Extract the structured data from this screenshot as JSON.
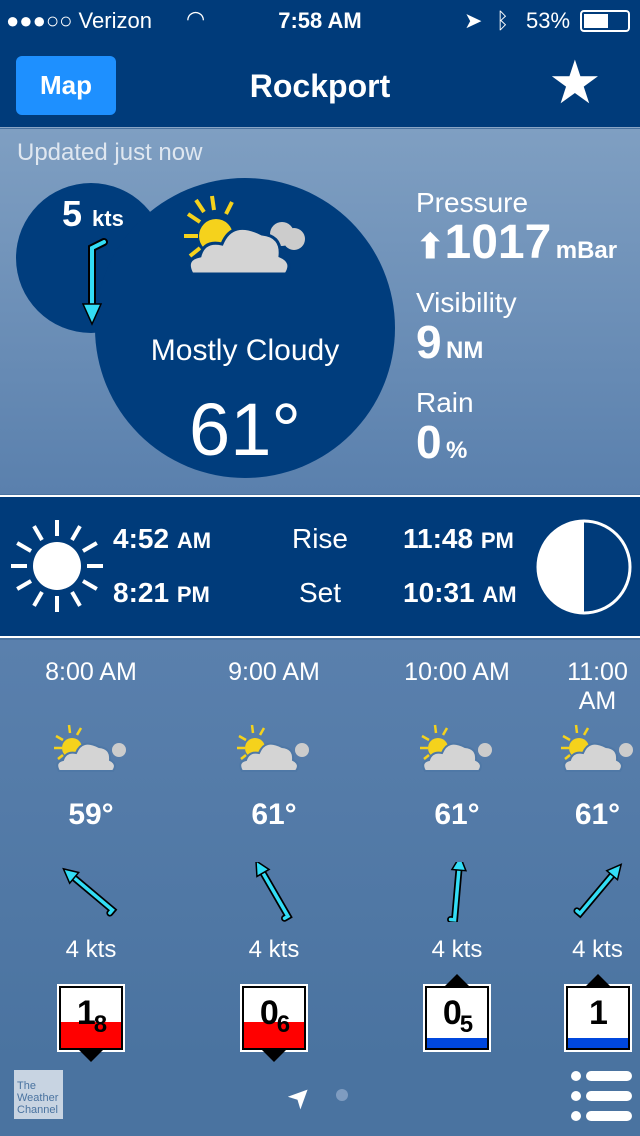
{
  "status": {
    "carrier": "●●●○○ Verizon",
    "time": "7:58 AM",
    "battery": "53%"
  },
  "nav": {
    "map_label": "Map",
    "title": "Rockport"
  },
  "current": {
    "updated": "Updated just now",
    "wind_speed": "5",
    "wind_unit": "kts",
    "condition": "Mostly Cloudy",
    "temp": "61°",
    "pressure_label": "Pressure",
    "pressure": "1017",
    "pressure_unit": "mBar",
    "pressure_trend": "rising",
    "visibility_label": "Visibility",
    "visibility": "9",
    "visibility_unit": "NM",
    "rain_label": "Rain",
    "rain": "0",
    "rain_unit": "%"
  },
  "sun_moon": {
    "sunrise": "4:52",
    "sunrise_ampm": "AM",
    "sunset": "8:21",
    "sunset_ampm": "PM",
    "rise_label": "Rise",
    "set_label": "Set",
    "moonrise": "11:48",
    "moonrise_ampm": "PM",
    "moonset": "10:31",
    "moonset_ampm": "AM",
    "moon_phase": "half"
  },
  "hourly": [
    {
      "time": "8:00 AM",
      "temp": "59°",
      "wind": "4 kts",
      "wind_rot": -140,
      "tide_big": "1",
      "tide_small": "8",
      "tide": "falling"
    },
    {
      "time": "9:00 AM",
      "temp": "61°",
      "wind": "4 kts",
      "wind_rot": -120,
      "tide_big": "0",
      "tide_small": "6",
      "tide": "falling"
    },
    {
      "time": "10:00 AM",
      "temp": "61°",
      "wind": "4 kts",
      "wind_rot": -85,
      "tide_big": "0",
      "tide_small": "5",
      "tide": "rising"
    },
    {
      "time": "11:00 AM",
      "temp": "61°",
      "wind": "4 kts",
      "wind_rot": -50,
      "tide_big": "1",
      "tide_small": "",
      "tide": "rising"
    }
  ],
  "footer": {
    "logo": "The Weather Channel"
  },
  "colors": {
    "navy": "#003b7a",
    "cyan": "#33ddf5",
    "red": "#ff0000",
    "blue": "#0047dd",
    "map_button": "#1e90ff"
  }
}
